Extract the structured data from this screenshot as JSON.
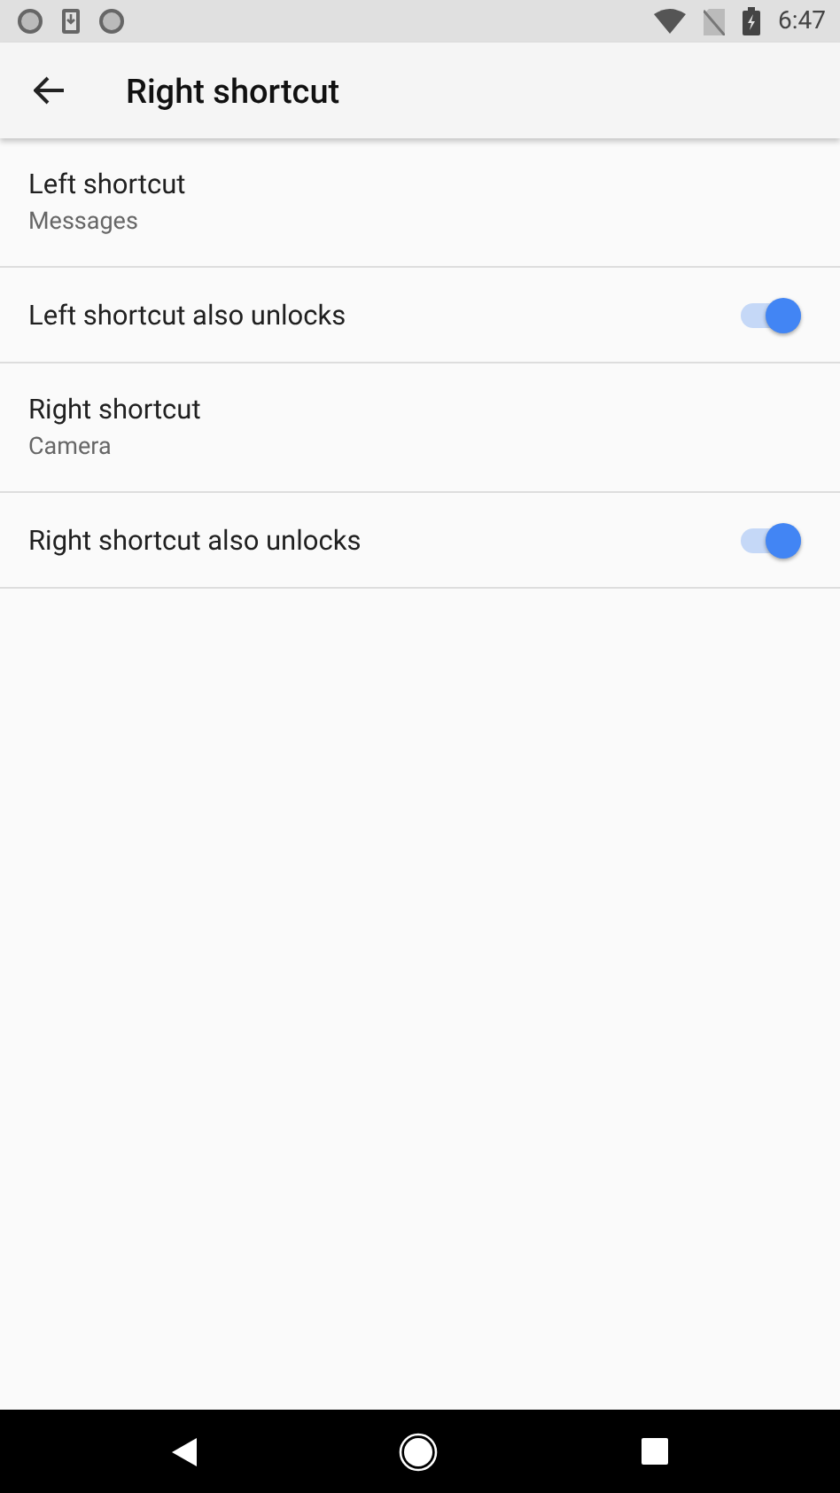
{
  "status_bar": {
    "time": "6:47"
  },
  "toolbar": {
    "title": "Right shortcut"
  },
  "settings": [
    {
      "kind": "choice",
      "title": "Left shortcut",
      "summary": "Messages"
    },
    {
      "kind": "switch",
      "title": "Left shortcut also unlocks",
      "on": true
    },
    {
      "kind": "choice",
      "title": "Right shortcut",
      "summary": "Camera"
    },
    {
      "kind": "switch",
      "title": "Right shortcut also unlocks",
      "on": true
    }
  ]
}
